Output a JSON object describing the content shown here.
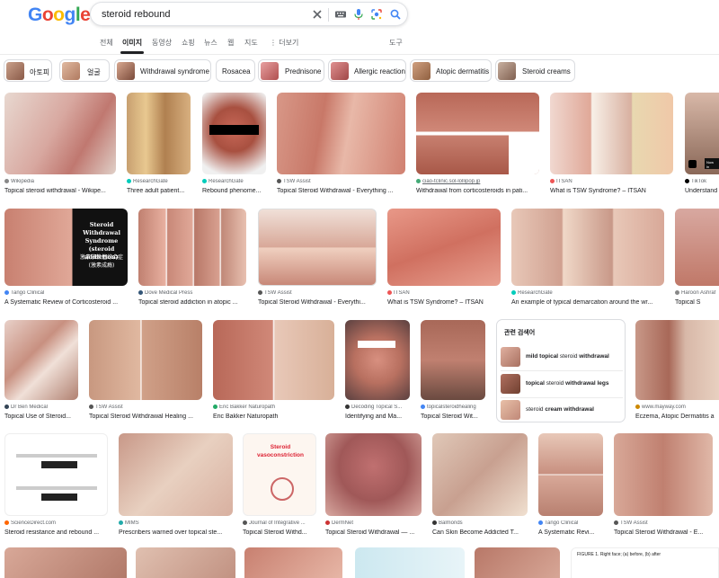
{
  "header": {
    "logo": "Google",
    "query": "steroid rebound",
    "icons": [
      "close-icon",
      "keyboard-icon",
      "microphone-icon",
      "lens-icon",
      "search-icon"
    ]
  },
  "tabs": [
    {
      "label": "전체",
      "active": false
    },
    {
      "label": "이미지",
      "active": true
    },
    {
      "label": "동영상",
      "active": false
    },
    {
      "label": "쇼핑",
      "active": false
    },
    {
      "label": "뉴스",
      "active": false
    },
    {
      "label": "웹",
      "active": false
    },
    {
      "label": "지도",
      "active": false
    },
    {
      "label": "⋮ 더보기",
      "active": false
    },
    {
      "label": "도구",
      "active": false
    }
  ],
  "chips": [
    "아토피",
    "얼굴",
    "Withdrawal syndrome",
    "Rosacea",
    "Prednisone",
    "Allergic reaction",
    "Atopic dermatitis",
    "Steroid creams"
  ],
  "results": [
    {
      "source": "Wikipedia",
      "title": "Topical steroid withdrawal - Wikipe..."
    },
    {
      "source": "ResearchGate",
      "title": "Three adult patient..."
    },
    {
      "source": "ResearchGate",
      "title": "Rebound phenome..."
    },
    {
      "source": "TSW Assist",
      "title": "Topical Steroid Withdrawal - Everything ..."
    },
    {
      "source": "ciao-tclinic.sol-lollipop.jp",
      "title": "Withdrawal from corticosteroids in pati..."
    },
    {
      "source": "ITSAN",
      "title": "What is TSW Syndrome? – ITSAN"
    },
    {
      "source": "TikTok",
      "title": "Understand"
    },
    {
      "source": "Tango Clinical",
      "title": "A Systematic Review of Corticosteroid ..."
    },
    {
      "source": "Dove Medical Press",
      "title": "Topical steroid addiction in atopic ..."
    },
    {
      "source": "TSW Assist",
      "title": "Topical Steroid Withdrawal - Everythi..."
    },
    {
      "source": "ITSAN",
      "title": "What is TSW Syndrome? – ITSAN"
    },
    {
      "source": "ResearchGate",
      "title": "An example of typical demarcation around the wr..."
    },
    {
      "source": "Haroon Ashraf",
      "title": "Topical S"
    },
    {
      "source": "Dr Ben Medical",
      "title": "Topical Use of Steroid..."
    },
    {
      "source": "TSW Assist",
      "title": "Topical Steroid Withdrawal Healing ..."
    },
    {
      "source": "Eric Bakker Naturopath",
      "title": "Eric Bakker Naturopath"
    },
    {
      "source": "Decoding Topical S...",
      "title": "Identifying and Ma..."
    },
    {
      "source": "topicalsteroidhealing",
      "title": "Topical Steroid Wit..."
    },
    {
      "source": "www.mayway.com",
      "title": "Eczema, Atopic Dermatitis a"
    },
    {
      "source": "ScienceDirect.com",
      "title": "Steroid resistance and rebound ..."
    },
    {
      "source": "MIMS",
      "title": "Prescribers warned over topical ste..."
    },
    {
      "source": "Journal of Integrative ...",
      "title": "Topical Steroid Withd..."
    },
    {
      "source": "DermNet",
      "title": "Topical Steroid Withdrawal — ..."
    },
    {
      "source": "Balmonds",
      "title": "Can Skin Become Addicted T..."
    },
    {
      "source": "Tango Clinical",
      "title": "A Systematic Revi..."
    },
    {
      "source": "TSW Assist",
      "title": "Topical Steroid Withdrawal - E..."
    }
  ],
  "image_text": {
    "tango_overlay": "Steroid Withdrawal Syndrome (steroid addiction)",
    "tango_overlay_cjk": "激素依赖性综合症 (激素成瘾)",
    "vasoconstriction": "Steroid vasoconstriction",
    "tiktok_badge": "Now in",
    "figure_caption": "FIGURE 1. Right face; (a) before, (b) after"
  },
  "related": {
    "title": "관련 검색어",
    "items": [
      {
        "bold": "mild topical",
        "normal": " steroid ",
        "bold2": "withdrawal"
      },
      {
        "bold": "topical",
        "normal": " steroid ",
        "bold2": "withdrawal legs"
      },
      {
        "bold": "",
        "normal": "steroid ",
        "bold2": "cream withdrawal"
      }
    ]
  },
  "colors": {
    "google_blue": "#4285F4",
    "google_red": "#EA4335",
    "google_yellow": "#FBBC05",
    "google_green": "#34A853",
    "text": "#202124",
    "muted": "#5f6368"
  }
}
